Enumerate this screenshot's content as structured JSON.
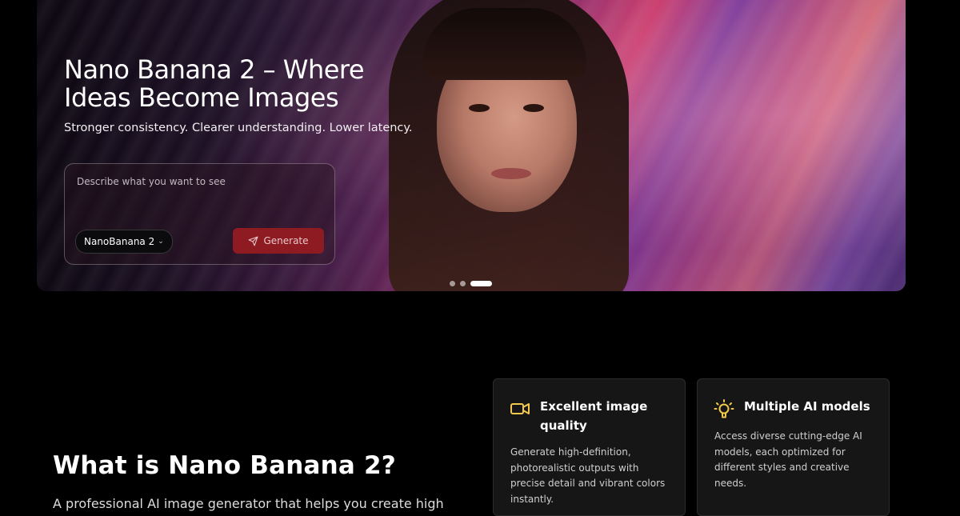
{
  "hero": {
    "title": "Nano Banana 2 – Where Ideas Become Images",
    "subtitle": "Stronger consistency. Clearer understanding. Lower latency.",
    "prompt_placeholder": "Describe what you want to see",
    "model_selected": "NanoBanana 2",
    "generate_label": "Generate",
    "carousel": {
      "total_slides": 3,
      "active_slide": 3
    }
  },
  "about": {
    "title": "What is Nano Banana 2?",
    "description_partial": "A professional AI image generator that helps you create high"
  },
  "features": [
    {
      "icon": "video-camera-icon",
      "title": "Excellent image quality",
      "text": "Generate high-definition, photorealistic outputs with precise detail and vibrant colors instantly."
    },
    {
      "icon": "lightbulb-icon",
      "title": "Multiple AI models",
      "text": "Access diverse cutting-edge AI models, each optimized for different styles and creative needs."
    }
  ],
  "colors": {
    "background": "#000000",
    "generate_button": "#8e1a22",
    "icon_accent": "#f2c94c",
    "card_background": "#161616"
  }
}
